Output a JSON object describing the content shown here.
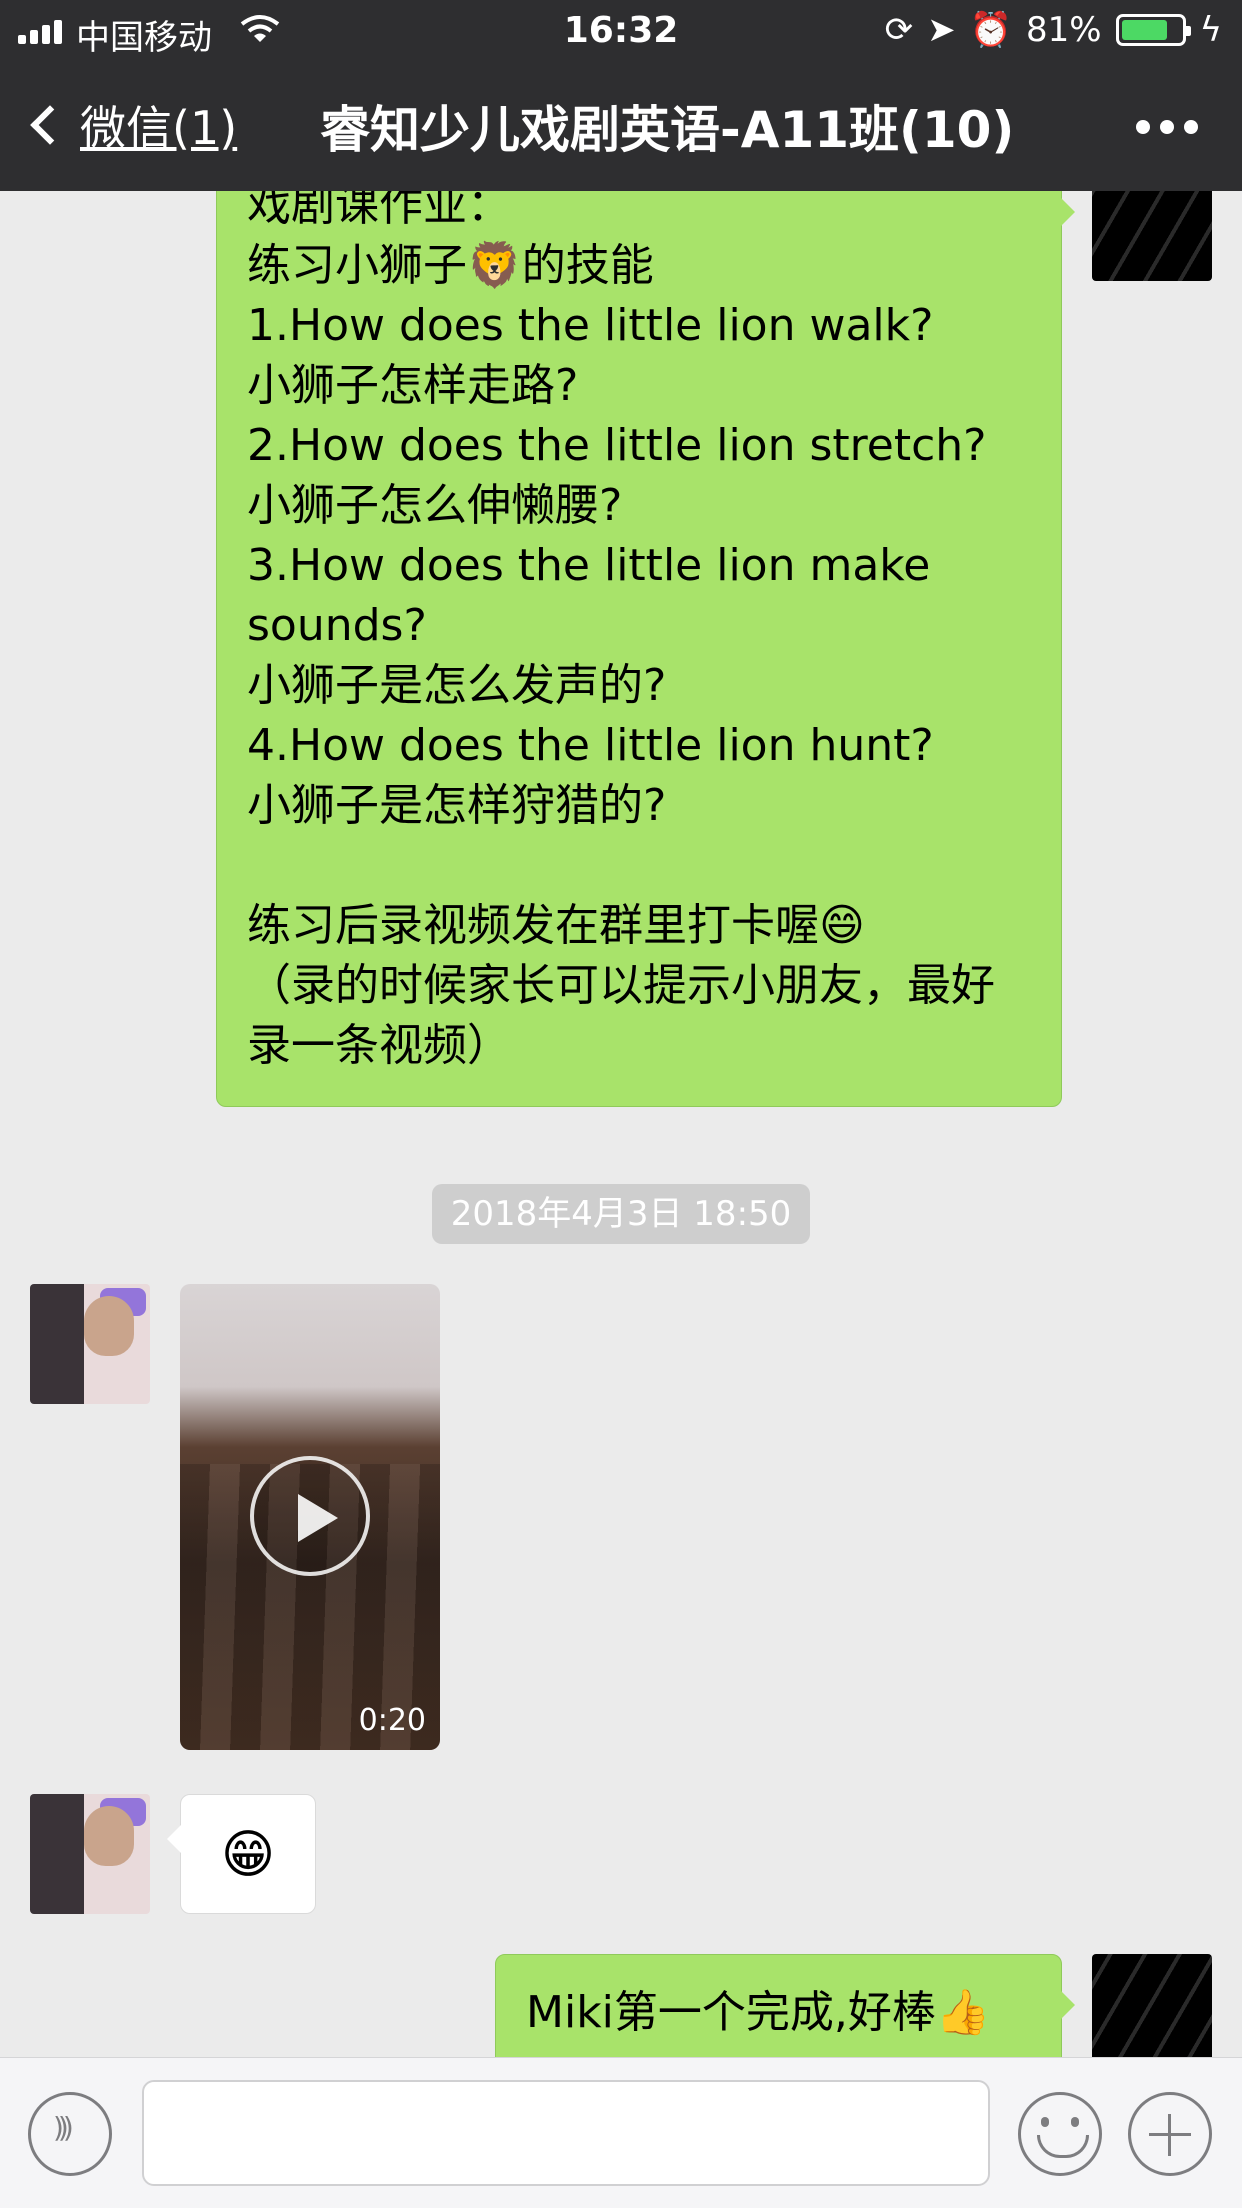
{
  "status_bar": {
    "carrier": "中国移动",
    "time": "16:32",
    "battery_percent": "81%",
    "battery_level": 0.81,
    "icons": [
      "signal-icon",
      "wifi-icon",
      "rotation-lock-icon",
      "location-icon",
      "alarm-icon",
      "battery-icon",
      "charging-icon"
    ]
  },
  "nav": {
    "back_label": "微信(1)",
    "title": "睿知少儿戏剧英语-A11班(10)",
    "more_icon": "more-dots-icon"
  },
  "messages": [
    {
      "side": "right",
      "type": "text",
      "text": "戏剧课作业：\n练习小狮子🦁的技能\n1.How does the little lion walk?\n小狮子怎样走路?\n2.How does the little lion stretch?\n小狮子怎么伸懒腰?\n3.How does the little lion make sounds?\n小狮子是怎么发声的?\n4.How does the little lion hunt?\n小狮子是怎样狩猎的?\n\n练习后录视频发在群里打卡喔😄\n（录的时候家长可以提示小朋友，最好录一条视频）"
    },
    {
      "type": "timestamp",
      "text": "2018年4月3日 18:50"
    },
    {
      "side": "left",
      "type": "video",
      "duration": "0:20"
    },
    {
      "side": "left",
      "type": "text",
      "text": "😁"
    },
    {
      "side": "right",
      "type": "text",
      "text": "Miki第一个完成,好棒👍"
    }
  ],
  "input_bar": {
    "icons": [
      "voice-icon",
      "emoji-icon",
      "plus-icon"
    ],
    "text_value": ""
  },
  "colors": {
    "nav_bg": "#2e2e30",
    "chat_bg": "#ebebeb",
    "bubble_green": "#a8e36a",
    "battery_green": "#4cd964"
  }
}
